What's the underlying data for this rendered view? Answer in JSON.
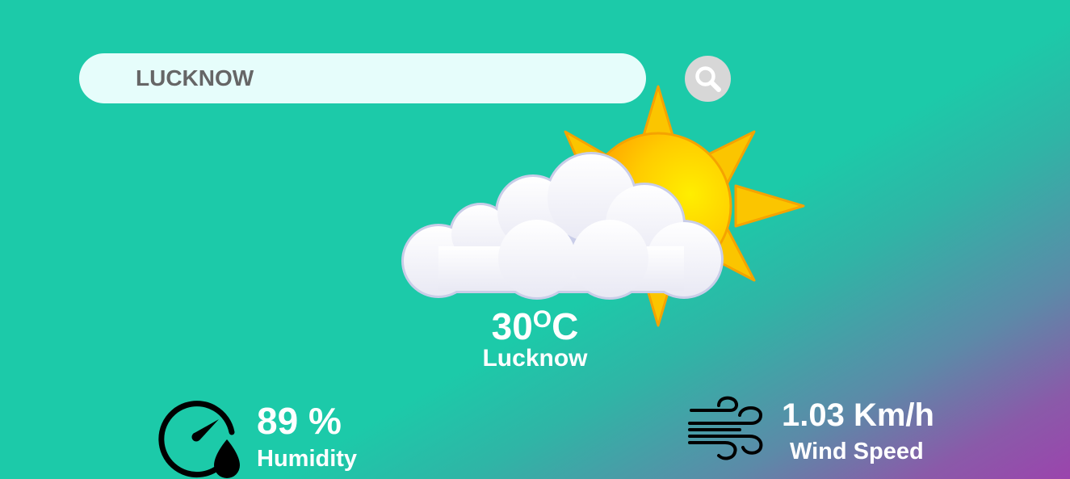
{
  "search": {
    "value": "LUCKNOW",
    "button_icon": "search-icon"
  },
  "weather": {
    "icon": "partly-cloudy-icon",
    "temperature": "30",
    "unit_superscript": "O",
    "unit_letter": "C",
    "city": "Lucknow"
  },
  "humidity": {
    "icon": "humidity-gauge-icon",
    "value": "89 %",
    "label": "Humidity"
  },
  "wind": {
    "icon": "wind-icon",
    "value": "1.03 Km/h",
    "label": "Wind Speed"
  },
  "colors": {
    "background": "#1ccaa9",
    "gradient_end": "#9b44ad",
    "search_bg": "#e6fdfb",
    "search_button_bg": "#d7d7d7",
    "search_text": "#666666",
    "text": "#ffffff"
  }
}
